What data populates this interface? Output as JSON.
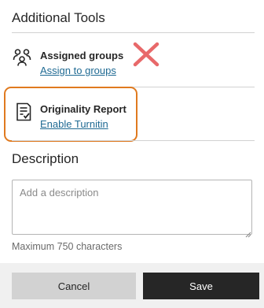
{
  "additional_tools": {
    "heading": "Additional Tools",
    "groups": {
      "title": "Assigned groups",
      "link": "Assign to groups",
      "icon": "people-group-icon"
    },
    "originality": {
      "title": "Originality Report",
      "link": "Enable Turnitin",
      "icon": "document-check-icon"
    }
  },
  "annotations": {
    "highlight_color": "#e07a1f",
    "x_mark_color": "#e8696a"
  },
  "description": {
    "heading": "Description",
    "value": "",
    "placeholder": "Add a description",
    "hint": "Maximum 750 characters"
  },
  "footer": {
    "cancel_label": "Cancel",
    "save_label": "Save"
  }
}
